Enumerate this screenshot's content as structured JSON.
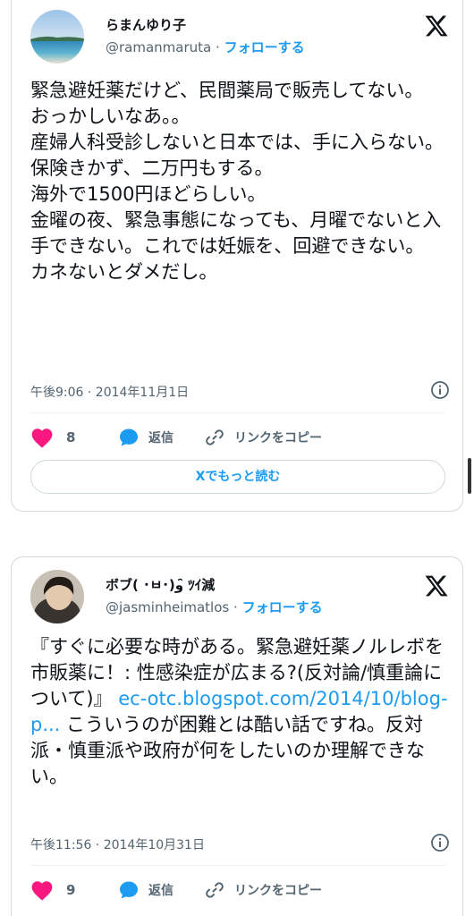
{
  "tweets": [
    {
      "author_name": "らまんゆり子",
      "handle": "@ramanmaruta",
      "separator": "·",
      "follow_label": "フォローする",
      "text": "緊急避妊薬だけど、民間薬局で販売してない。\nおっかしいなあ。。\n産婦人科受診しないと日本では、手に入らない。\n保険きかず、二万円もする。\n海外で1500円ほどらしい。\n金曜の夜、緊急事態になっても、月曜でないと入手できない。これでは妊娠を、回避できない。\nカネないとダメだし。",
      "timestamp": "午後9:06 · 2014年11月1日",
      "likes": "8",
      "reply_label": "返信",
      "copy_link_label": "リンクをコピー",
      "read_more_label": "Xでもっと読む"
    },
    {
      "author_name": "ボブ( ･ㅂ･)و ̑̑ﾂｲ減",
      "handle": "@jasminheimatlos",
      "separator": "·",
      "follow_label": "フォローする",
      "text_before_link": "『すぐに必要な時がある。緊急避妊薬ノルレボを市販薬に！: 性感染症が広まる?(反対論/慎重論について)』 ",
      "link_text": "ec-otc.blogspot.com/2014/10/blog-p...",
      "text_after_link": " こういうのが困難とは酷い話ですね。反対派・慎重派や政府が何をしたいのか理解できない。",
      "timestamp": "午後11:56 · 2014年10月31日",
      "likes": "9",
      "reply_label": "返信",
      "copy_link_label": "リンクをコピー"
    }
  ],
  "colors": {
    "link": "#1d9bf0",
    "like": "#f91880",
    "reply": "#1d9bf0",
    "muted": "#536471",
    "border": "#cfd9de"
  },
  "icons": [
    "x-logo-icon",
    "info-icon",
    "heart-icon",
    "reply-bubble-icon",
    "link-icon"
  ]
}
